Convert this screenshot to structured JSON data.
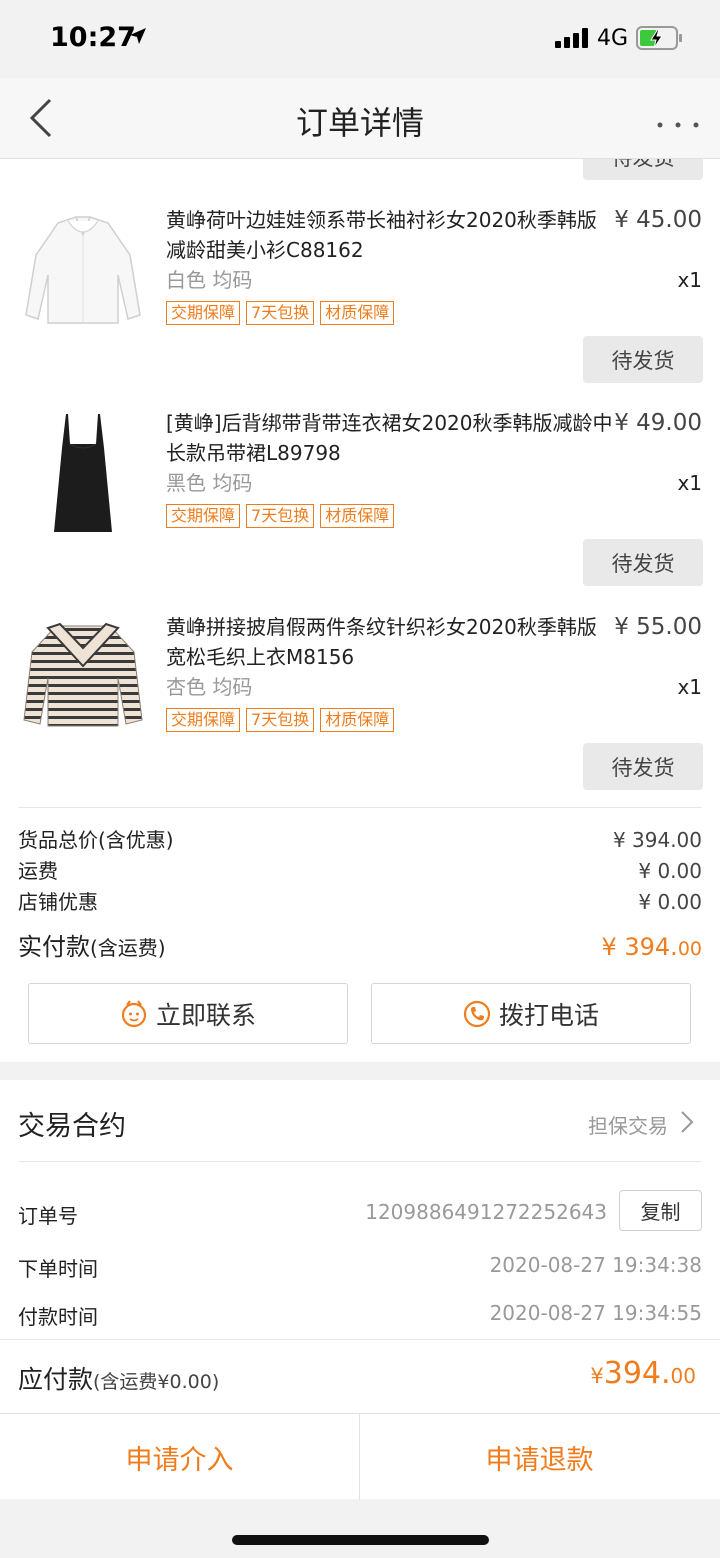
{
  "status_bar": {
    "time": "10:27",
    "network": "4G"
  },
  "nav": {
    "title": "订单详情"
  },
  "order": {
    "ship_status_label": "待发货",
    "products": [
      {
        "name": "黄峥荷叶边娃娃领系带长袖衬衫女2020秋季韩版减龄甜美小衫C88162",
        "price": "¥ 45.00",
        "spec": "白色 均码",
        "qty": "x1",
        "thumb": "white-blouse"
      },
      {
        "name": "[黄峥]后背绑带背带连衣裙女2020秋季韩版减龄中长款吊带裙L89798",
        "price": "¥ 49.00",
        "spec": "黑色 均码",
        "qty": "x1",
        "thumb": "black-dress"
      },
      {
        "name": "黄峥拼接披肩假两件条纹针织衫女2020秋季韩版宽松毛织上衣M8156",
        "price": "¥ 55.00",
        "spec": "杏色 均码",
        "qty": "x1",
        "thumb": "striped-sweater"
      }
    ],
    "tags": [
      "交期保障",
      "7天包换",
      "材质保障"
    ],
    "summary": {
      "goods_total_label": "货品总价(含优惠)",
      "goods_total_value": "¥ 394.00",
      "shipping_label": "运费",
      "shipping_value": "¥ 0.00",
      "store_discount_label": "店铺优惠",
      "store_discount_value": "¥ 0.00",
      "paid_label": "实付款",
      "paid_sub": "(含运费)",
      "paid_value_main": "¥ 394.",
      "paid_value_decimal": "00"
    },
    "actions": {
      "contact_label": "立即联系",
      "call_label": "拨打电话"
    }
  },
  "contract": {
    "title": "交易合约",
    "type": "担保交易",
    "order_no_label": "订单号",
    "order_no": "1209886491272252643",
    "copy_label": "复制",
    "order_time_label": "下单时间",
    "order_time": "2020-08-27 19:34:38",
    "pay_time_label": "付款时间",
    "pay_time": "2020-08-27 19:34:55",
    "due_label": "应付款",
    "due_sub": "(含运费¥0.00)",
    "due_currency": "¥",
    "due_main": "394.",
    "due_decimal": "00"
  },
  "bottom": {
    "intervene_label": "申请介入",
    "refund_label": "申请退款"
  },
  "colors": {
    "accent": "#f07d1d",
    "button_gray": "#e9e9e9"
  }
}
